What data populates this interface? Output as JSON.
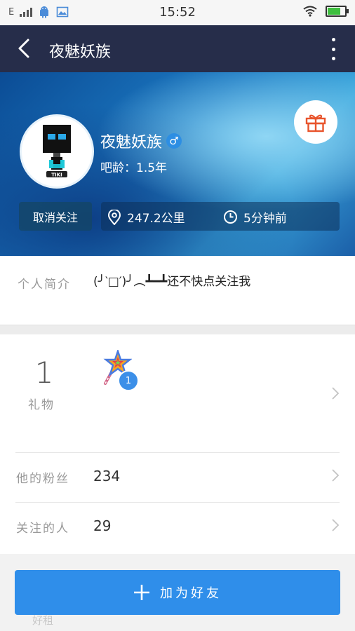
{
  "status_bar": {
    "network": "E",
    "time": "15:52"
  },
  "header": {
    "title": "夜魅妖族"
  },
  "profile": {
    "name": "夜魅妖族",
    "gender_symbol": "♂",
    "age_text": "吧龄：1.5年",
    "unfollow_label": "取消关注",
    "distance": "247.2公里",
    "last_active": "5分钟前"
  },
  "intro": {
    "label": "个人简介",
    "text": "(╯‵□′)╯︵┻━┻还不快点关注我"
  },
  "gifts": {
    "count": "1",
    "label": "礼物",
    "item_badge": "1"
  },
  "fans": {
    "label": "他的粉丝",
    "value": "234"
  },
  "following": {
    "label": "关注的人",
    "value": "29"
  },
  "bottom": {
    "add_friend_label": "加为好友",
    "hidden_text": "好租"
  },
  "colors": {
    "header_bg": "#262d4a",
    "accent": "#2f8eea"
  }
}
